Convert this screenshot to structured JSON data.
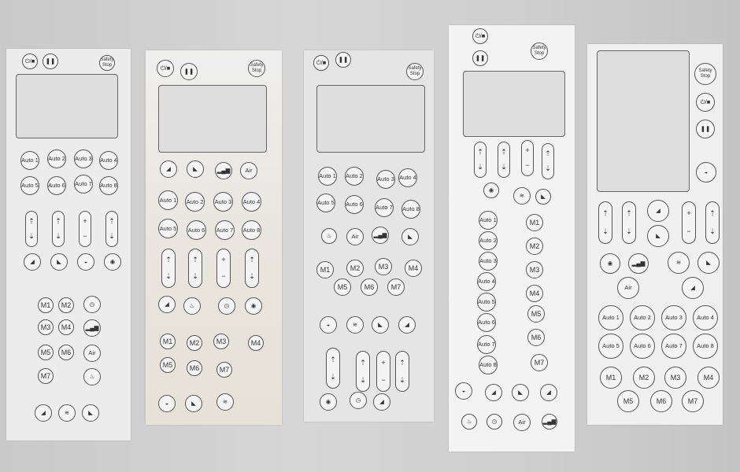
{
  "labels": {
    "safety_stop": "Safety Stop",
    "power_symbol": "⏻/■",
    "pause_symbol": "❚❚",
    "air": "Air",
    "auto": [
      "Auto 1",
      "Auto 2",
      "Auto 3",
      "Auto 4",
      "Auto 5",
      "Auto 6",
      "Auto 7",
      "Auto 8"
    ],
    "memory": [
      "M1",
      "M2",
      "M3",
      "M4",
      "M5",
      "M6",
      "M7"
    ],
    "up_arrow": "⇡",
    "down_arrow": "⇣",
    "plus": "+",
    "minus": "−"
  },
  "icons": [
    "power-stop-icon",
    "pause-icon",
    "recline-icon",
    "foot-massage-icon",
    "intensity-bars-icon",
    "air-icon",
    "timer-icon",
    "heat-icon",
    "zero-gravity-icon",
    "leg-rest-icon",
    "roller-icon",
    "back-rest-icon"
  ],
  "colors": {
    "background": "#cfcfcf",
    "panel": "#ececec",
    "line": "#555555"
  }
}
